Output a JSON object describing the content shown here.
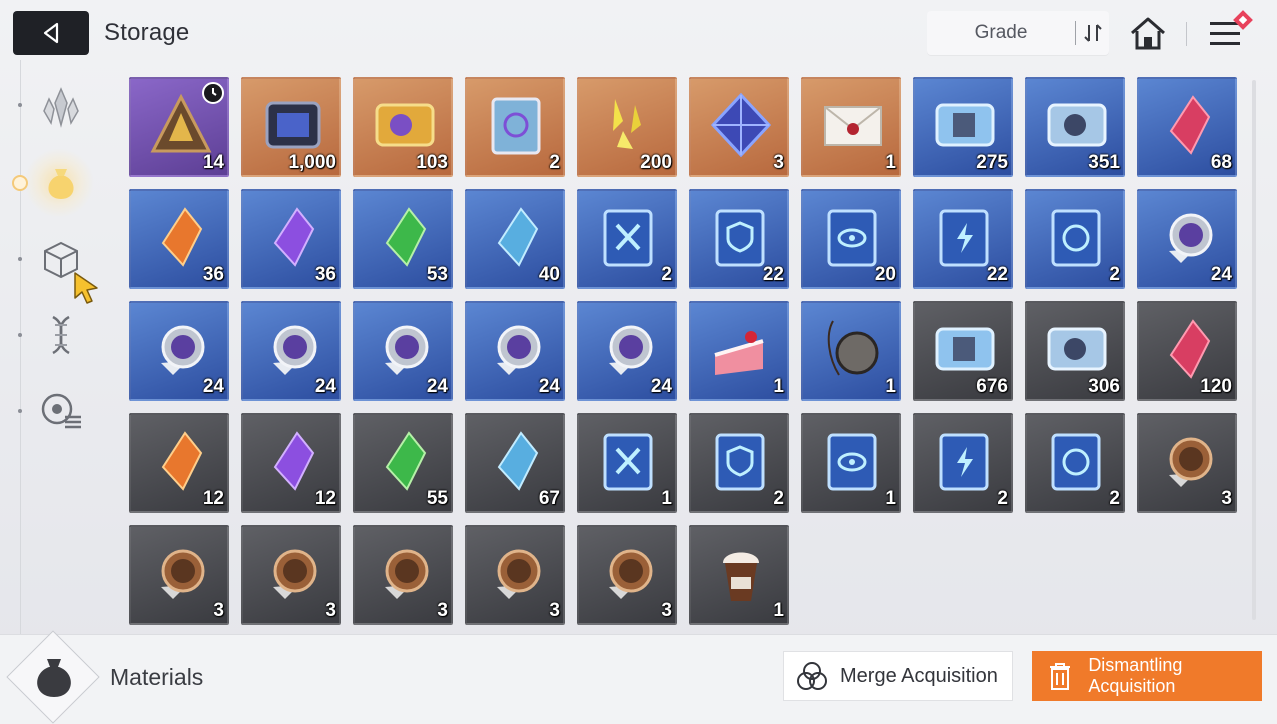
{
  "header": {
    "title": "Storage",
    "sort_label": "Grade"
  },
  "sidebar": {
    "items": [
      {
        "name": "crystals",
        "icon": "crystal-cluster-icon",
        "active": false
      },
      {
        "name": "materials",
        "icon": "money-bag-icon",
        "active": true
      },
      {
        "name": "boxes",
        "icon": "cube-icon",
        "active": false
      },
      {
        "name": "genes",
        "icon": "dna-icon",
        "active": false
      },
      {
        "name": "misc",
        "icon": "gear-list-icon",
        "active": false
      }
    ]
  },
  "items": [
    {
      "rarity": "purple",
      "icon": "triangle-pyramid-icon",
      "count": "14",
      "timer": true
    },
    {
      "rarity": "orange",
      "icon": "chip-icon",
      "count": "1,000"
    },
    {
      "rarity": "orange",
      "icon": "gold-ticket-icon",
      "count": "103"
    },
    {
      "rarity": "orange",
      "icon": "rainbow-book-icon",
      "count": "2"
    },
    {
      "rarity": "orange",
      "icon": "yellow-shards-icon",
      "count": "200"
    },
    {
      "rarity": "orange",
      "icon": "blue-octahedron-icon",
      "count": "3"
    },
    {
      "rarity": "orange",
      "icon": "sealed-letter-icon",
      "count": "1"
    },
    {
      "rarity": "blue",
      "icon": "id-ticket-icon",
      "count": "275"
    },
    {
      "rarity": "blue",
      "icon": "star-ticket-icon",
      "count": "351"
    },
    {
      "rarity": "blue",
      "icon": "red-crystal-icon",
      "count": "68"
    },
    {
      "rarity": "blue",
      "icon": "orange-crystal-icon",
      "count": "36"
    },
    {
      "rarity": "blue",
      "icon": "purple-crystal-icon",
      "count": "36"
    },
    {
      "rarity": "blue",
      "icon": "green-crystal-icon",
      "count": "53"
    },
    {
      "rarity": "blue",
      "icon": "cyan-crystal-icon",
      "count": "40"
    },
    {
      "rarity": "blue",
      "icon": "sword-book-icon",
      "count": "2"
    },
    {
      "rarity": "blue",
      "icon": "shield-book-icon",
      "count": "22"
    },
    {
      "rarity": "blue",
      "icon": "eye-book-icon",
      "count": "20"
    },
    {
      "rarity": "blue",
      "icon": "lightning-book-icon",
      "count": "22"
    },
    {
      "rarity": "blue",
      "icon": "orb-book-icon",
      "count": "2"
    },
    {
      "rarity": "blue",
      "icon": "medal-icon",
      "count": "24"
    },
    {
      "rarity": "blue",
      "icon": "medal-icon",
      "count": "24"
    },
    {
      "rarity": "blue",
      "icon": "medal-icon",
      "count": "24"
    },
    {
      "rarity": "blue",
      "icon": "medal-icon",
      "count": "24"
    },
    {
      "rarity": "blue",
      "icon": "medal-icon",
      "count": "24"
    },
    {
      "rarity": "blue",
      "icon": "medal-icon",
      "count": "24"
    },
    {
      "rarity": "blue",
      "icon": "cake-icon",
      "count": "1"
    },
    {
      "rarity": "blue",
      "icon": "pocket-watch-icon",
      "count": "1"
    },
    {
      "rarity": "gray",
      "icon": "id-ticket-icon",
      "count": "676"
    },
    {
      "rarity": "gray",
      "icon": "star-ticket-icon",
      "count": "306"
    },
    {
      "rarity": "gray",
      "icon": "red-crystal-icon",
      "count": "120"
    },
    {
      "rarity": "gray",
      "icon": "orange-crystal-icon",
      "count": "12"
    },
    {
      "rarity": "gray",
      "icon": "purple-crystal-icon",
      "count": "12"
    },
    {
      "rarity": "gray",
      "icon": "green-crystal-icon",
      "count": "55"
    },
    {
      "rarity": "gray",
      "icon": "cyan-crystal-icon",
      "count": "67"
    },
    {
      "rarity": "gray",
      "icon": "sword-book-icon",
      "count": "1"
    },
    {
      "rarity": "gray",
      "icon": "shield-book-icon",
      "count": "2"
    },
    {
      "rarity": "gray",
      "icon": "eye-book-icon",
      "count": "1"
    },
    {
      "rarity": "gray",
      "icon": "lightning-book-icon",
      "count": "2"
    },
    {
      "rarity": "gray",
      "icon": "orb-book-icon",
      "count": "2"
    },
    {
      "rarity": "gray",
      "icon": "bronze-medal-icon",
      "count": "3"
    },
    {
      "rarity": "gray",
      "icon": "bronze-medal-icon",
      "count": "3"
    },
    {
      "rarity": "gray",
      "icon": "bronze-medal-icon",
      "count": "3"
    },
    {
      "rarity": "gray",
      "icon": "bronze-medal-icon",
      "count": "3"
    },
    {
      "rarity": "gray",
      "icon": "bronze-medal-icon",
      "count": "3"
    },
    {
      "rarity": "gray",
      "icon": "bronze-medal-icon",
      "count": "3"
    },
    {
      "rarity": "gray",
      "icon": "frappe-icon",
      "count": "1"
    }
  ],
  "footer": {
    "category_label": "Materials",
    "merge_label": "Merge Acquisition",
    "dismantle_label": "Dismantling Acquisition"
  },
  "colors": {
    "accent_orange": "#f07a2a",
    "back_button": "#1f2126",
    "rarity_purple": "#6e4fae",
    "rarity_orange": "#c7794a",
    "rarity_blue": "#3c61b6",
    "rarity_gray": "#4b4c51"
  }
}
